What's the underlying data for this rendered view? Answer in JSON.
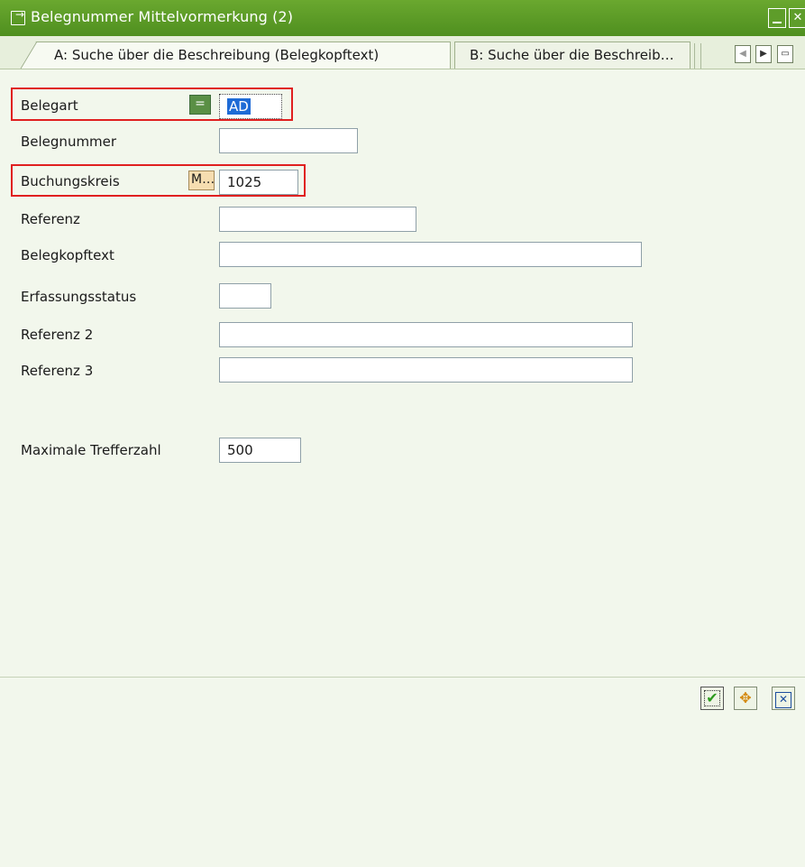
{
  "window": {
    "title": "Belegnummer Mittelvormerkung (2)",
    "minimize_icon": "minimize-icon",
    "close_icon": "close-icon"
  },
  "tabs": [
    {
      "label": "A: Suche über die Beschreibung (Belegkopftext)",
      "active": true
    },
    {
      "label": "B: Suche über die Beschreib…",
      "active": false
    }
  ],
  "tab_nav": {
    "prev_icon": "scroll-left-icon",
    "next_icon": "scroll-right-icon",
    "list_icon": "tab-list-icon"
  },
  "form": {
    "belegart": {
      "label": "Belegart",
      "operator_icon": "equals-icon",
      "value": "AD"
    },
    "belegnummer": {
      "label": "Belegnummer",
      "value": ""
    },
    "buchungskreis": {
      "label": "Buchungskreis",
      "operator_label": "M…",
      "value": "1025"
    },
    "referenz": {
      "label": "Referenz",
      "value": ""
    },
    "belegkopftext": {
      "label": "Belegkopftext",
      "value": ""
    },
    "erfassungsstatus": {
      "label": "Erfassungsstatus",
      "value": ""
    },
    "referenz2": {
      "label": "Referenz 2",
      "value": ""
    },
    "referenz3": {
      "label": "Referenz 3",
      "value": ""
    },
    "maxhits": {
      "label": "Maximale Trefferzahl",
      "value": "500"
    }
  },
  "buttons": {
    "ok_icon": "checkmark-icon",
    "tree_icon": "multiple-selection-icon",
    "cancel_icon": "cancel-icon"
  },
  "colors": {
    "titlebar": "#5a9a28",
    "highlight_red": "#e02020",
    "selection_blue": "#1e6bd6"
  }
}
